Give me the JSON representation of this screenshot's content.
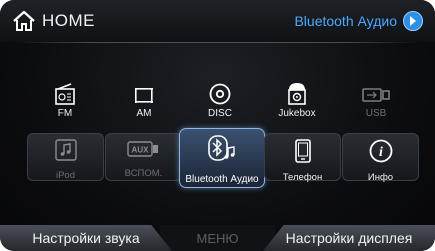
{
  "header": {
    "home_label": "HOME",
    "source_label": "Bluetooth Аудио"
  },
  "sources_row1": [
    {
      "label": "FM",
      "icon": "radio-icon",
      "enabled": true
    },
    {
      "label": "AM",
      "icon": "radio-icon",
      "enabled": true
    },
    {
      "label": "DISC",
      "icon": "disc-icon",
      "enabled": true
    },
    {
      "label": "Jukebox",
      "icon": "jukebox-icon",
      "enabled": true
    },
    {
      "label": "USB",
      "icon": "usb-icon",
      "enabled": false
    }
  ],
  "sources_row2": [
    {
      "label": "iPod",
      "icon": "music-note-icon",
      "enabled": false
    },
    {
      "label": "ВСПОМ.",
      "icon": "aux-icon",
      "enabled": false
    },
    {
      "label": "Bluetooth Аудио",
      "icon": "bluetooth-audio-icon",
      "enabled": true,
      "selected": true
    },
    {
      "label": "Телефон",
      "icon": "phone-icon",
      "enabled": true
    },
    {
      "label": "Инфо",
      "icon": "info-icon",
      "enabled": true
    }
  ],
  "footer": {
    "sound_settings": "Настройки звука",
    "menu": "МЕНЮ",
    "display_settings": "Настройки дисплея"
  },
  "colors": {
    "accent": "#4da8ff",
    "selected_border": "#8fb6e6",
    "disabled_text": "#6c6f74"
  }
}
